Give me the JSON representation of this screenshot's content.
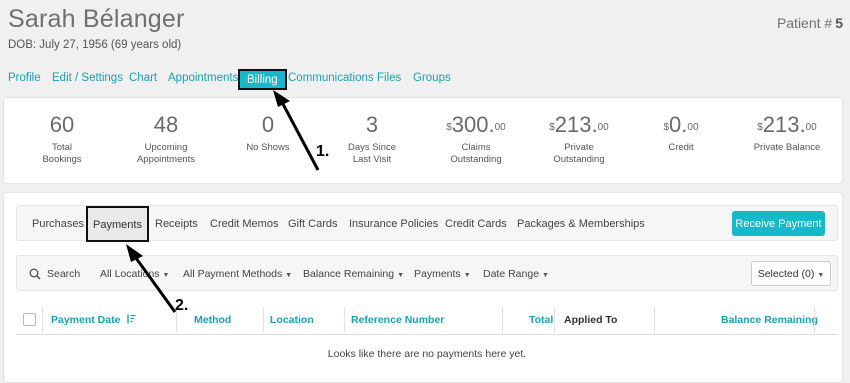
{
  "patient": {
    "name": "Sarah Bélanger",
    "dob": "DOB: July 27, 1956 (69 years old)",
    "number_label": "Patient #",
    "number": "5"
  },
  "nav": {
    "items": [
      {
        "label": "Profile"
      },
      {
        "label": "Edit / Settings"
      },
      {
        "label": "Chart"
      },
      {
        "label": "Appointments"
      },
      {
        "label": "Billing",
        "active": true
      },
      {
        "label": "Communications"
      },
      {
        "label": "Files"
      },
      {
        "label": "Groups"
      }
    ]
  },
  "stats": [
    {
      "value": "60",
      "label_1": "Total",
      "label_2": "Bookings"
    },
    {
      "value": "48",
      "label_1": "Upcoming",
      "label_2": "Appointments"
    },
    {
      "value": "0",
      "label_1": "No Shows",
      "label_2": ""
    },
    {
      "value": "3",
      "label_1": "Days Since",
      "label_2": "Last Visit"
    },
    {
      "prefix": "$",
      "value": "300.",
      "cents": "00",
      "label_1": "Claims",
      "label_2": "Outstanding"
    },
    {
      "prefix": "$",
      "value": "213.",
      "cents": "00",
      "label_1": "Private",
      "label_2": "Outstanding"
    },
    {
      "prefix": "$",
      "value": "0.",
      "cents": "00",
      "label_1": "Credit",
      "label_2": ""
    },
    {
      "prefix": "$",
      "value": "213.",
      "cents": "00",
      "label_1": "Private Balance",
      "label_2": ""
    }
  ],
  "billing_tabs": [
    {
      "label": "Purchases"
    },
    {
      "label": "Payments",
      "active": true
    },
    {
      "label": "Receipts"
    },
    {
      "label": "Credit Memos"
    },
    {
      "label": "Gift Cards"
    },
    {
      "label": "Insurance Policies"
    },
    {
      "label": "Credit Cards"
    },
    {
      "label": "Packages & Memberships"
    }
  ],
  "receive_payment_label": "Receive Payment",
  "filters": {
    "search_label": "Search",
    "all_locations": "All Locations",
    "all_payment_methods": "All Payment Methods",
    "balance_remaining": "Balance Remaining",
    "payments": "Payments",
    "date_range": "Date Range",
    "selected": "Selected (0)"
  },
  "table": {
    "columns": {
      "payment_date": "Payment Date",
      "method": "Method",
      "location": "Location",
      "reference_number": "Reference Number",
      "total": "Total",
      "applied_to": "Applied To",
      "balance_remaining": "Balance Remaining"
    },
    "empty_message": "Looks like there are no payments here yet."
  },
  "annotations": {
    "step_1": "1.",
    "step_2": "2."
  },
  "colors": {
    "accent": "#17b8c9",
    "link": "#1aa0b4"
  }
}
